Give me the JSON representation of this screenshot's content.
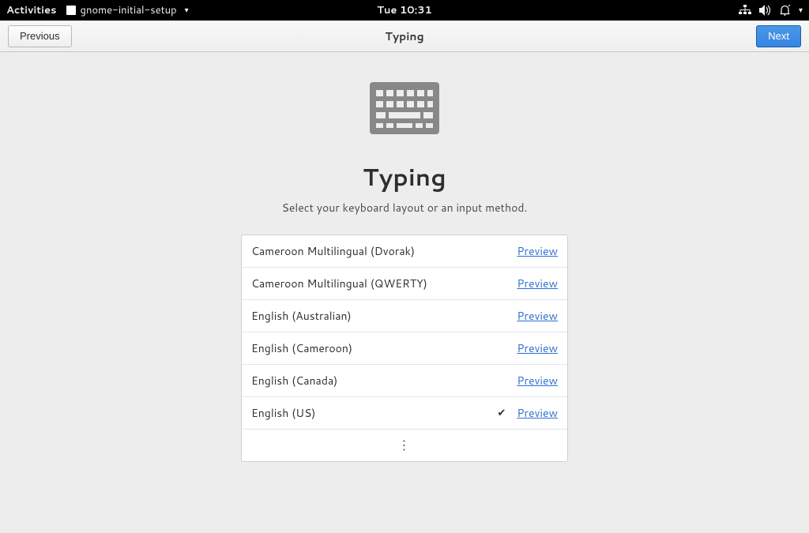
{
  "topbar": {
    "activities": "Activities",
    "appname": "gnome-initial-setup",
    "clock": "Tue 10:31"
  },
  "headerbar": {
    "previous": "Previous",
    "title": "Typing",
    "next": "Next"
  },
  "page": {
    "title": "Typing",
    "subtitle": "Select your keyboard layout or an input method."
  },
  "preview_label": "Preview",
  "layouts": [
    {
      "name": "Cameroon Multilingual (Dvorak)",
      "selected": false
    },
    {
      "name": "Cameroon Multilingual (QWERTY)",
      "selected": false
    },
    {
      "name": "English (Australian)",
      "selected": false
    },
    {
      "name": "English (Cameroon)",
      "selected": false
    },
    {
      "name": "English (Canada)",
      "selected": false
    },
    {
      "name": "English (US)",
      "selected": true
    }
  ]
}
